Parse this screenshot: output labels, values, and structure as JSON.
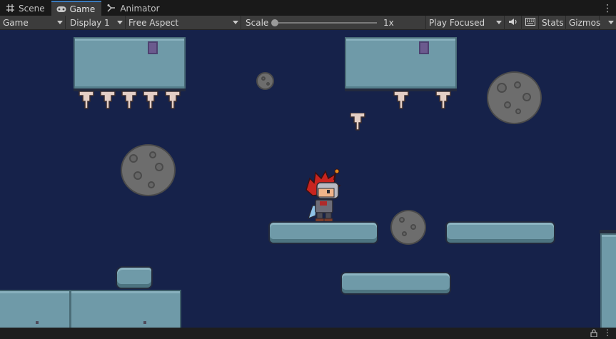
{
  "tabs": [
    {
      "label": "Scene",
      "icon": "grid-icon"
    },
    {
      "label": "Game",
      "icon": "gamepad-icon"
    },
    {
      "label": "Animator",
      "icon": "animator-icon"
    }
  ],
  "toolbar": {
    "view_dropdown": "Game",
    "display_dropdown": "Display 1",
    "aspect_dropdown": "Free Aspect",
    "scale_label": "Scale",
    "scale_value": "1x",
    "play_mode_dropdown": "Play Focused",
    "stats_label": "Stats",
    "gizmos_label": "Gizmos"
  },
  "colors": {
    "background": "#16224a",
    "tile": "#6f9aa8",
    "accent": "#3a79bb"
  }
}
